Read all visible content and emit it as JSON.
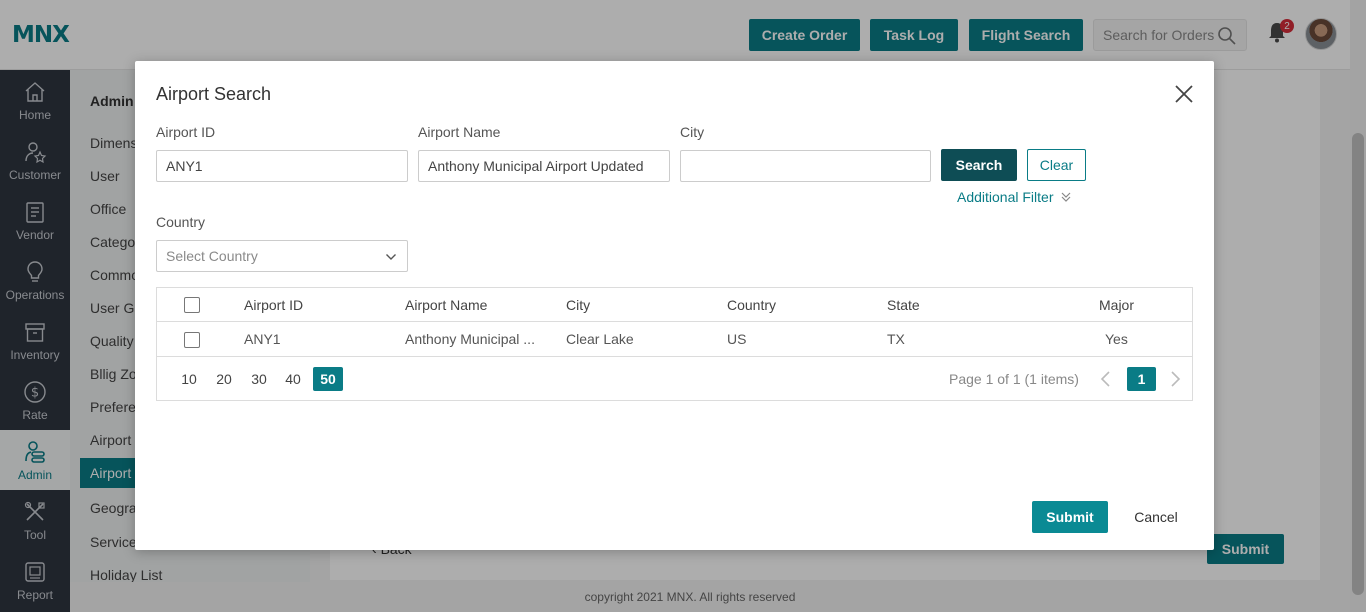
{
  "header": {
    "logo": "MNX",
    "buttons": {
      "create_order": "Create Order",
      "task_log": "Task Log",
      "flight_search": "Flight Search"
    },
    "search_placeholder": "Search for Orders",
    "notification_count": "2"
  },
  "leftnav": [
    {
      "label": "Home",
      "icon": "home-icon"
    },
    {
      "label": "Customer",
      "icon": "customer-icon"
    },
    {
      "label": "Vendor",
      "icon": "vendor-icon"
    },
    {
      "label": "Operations",
      "icon": "lightbulb-icon"
    },
    {
      "label": "Inventory",
      "icon": "inventory-icon"
    },
    {
      "label": "Rate",
      "icon": "dollar-icon"
    },
    {
      "label": "Admin",
      "icon": "admin-icon",
      "active": true
    },
    {
      "label": "Tool",
      "icon": "tool-icon"
    },
    {
      "label": "Report",
      "icon": "report-icon"
    }
  ],
  "admin_panel": {
    "title": "Admin",
    "items": [
      "Dimens",
      "User",
      "Office",
      "Catego",
      "Commo",
      "User Gr",
      "Quality",
      "Bllig Zo",
      "Prefere",
      "Airport",
      "Airport",
      "Geogra",
      "Service",
      "Holiday List"
    ],
    "active_index": 10
  },
  "main": {
    "back_label": "Back",
    "submit_label": "Submit",
    "footer": "copyright 2021 MNX. All rights reserved"
  },
  "modal": {
    "title": "Airport Search",
    "fields": {
      "airport_id": {
        "label": "Airport ID",
        "value": "ANY1"
      },
      "airport_name": {
        "label": "Airport Name",
        "value": "Anthony Municipal Airport Updated"
      },
      "city": {
        "label": "City",
        "value": ""
      },
      "country": {
        "label": "Country",
        "placeholder": "Select Country"
      }
    },
    "search_label": "Search",
    "clear_label": "Clear",
    "additional_filter": "Additional Filter",
    "grid": {
      "columns": [
        "Airport ID",
        "Airport Name",
        "City",
        "Country",
        "State",
        "Major"
      ],
      "rows": [
        [
          "ANY1",
          "Anthony Municipal ...",
          "Clear Lake",
          "US",
          "TX",
          "Yes"
        ]
      ],
      "page_sizes": [
        "10",
        "20",
        "30",
        "40",
        "50"
      ],
      "active_page_size": "50",
      "page_info": "Page 1 of 1 (1 items)",
      "current_page": "1"
    },
    "submit_label": "Submit",
    "cancel_label": "Cancel"
  },
  "colors": {
    "accent": "#0a7c86",
    "dark_accent": "#0e4d55",
    "nav_bg": "#2f3540"
  }
}
